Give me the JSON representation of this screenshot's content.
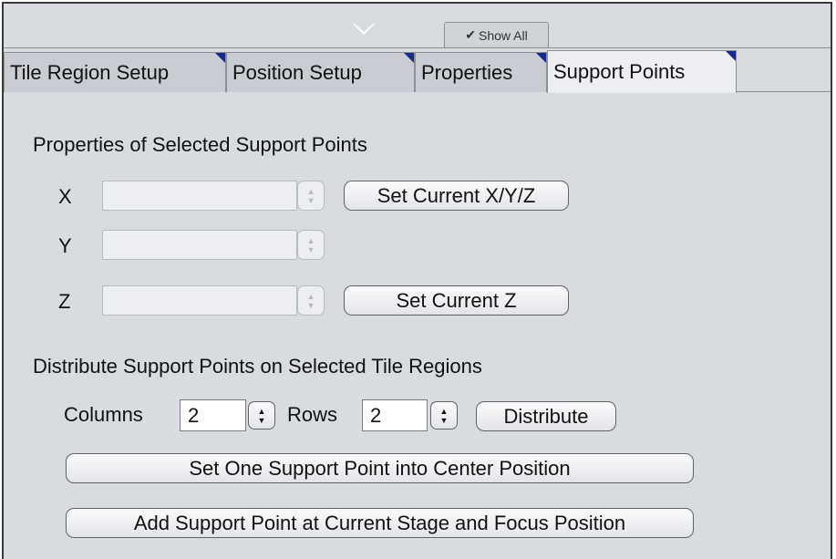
{
  "show_all": {
    "check": "✔",
    "label": "Show All"
  },
  "tabs": [
    {
      "label": "Tile Region Setup"
    },
    {
      "label": "Position Setup"
    },
    {
      "label": "Properties"
    },
    {
      "label": "Support Points"
    }
  ],
  "properties_section": {
    "title": "Properties of Selected Support Points",
    "x_label": "X",
    "y_label": "Y",
    "z_label": "Z",
    "x_value": "",
    "y_value": "",
    "z_value": "",
    "set_xyz_button": "Set Current X/Y/Z",
    "set_z_button": "Set Current Z"
  },
  "distribute_section": {
    "title": "Distribute Support Points on Selected Tile Regions",
    "columns_label": "Columns",
    "columns_value": "2",
    "rows_label": "Rows",
    "rows_value": "2",
    "distribute_button": "Distribute",
    "center_button": "Set One Support Point into Center Position",
    "add_point_button": "Add Support Point at Current Stage and Focus Position"
  },
  "icons": {
    "up_arrow": "▲",
    "down_arrow": "▼"
  }
}
